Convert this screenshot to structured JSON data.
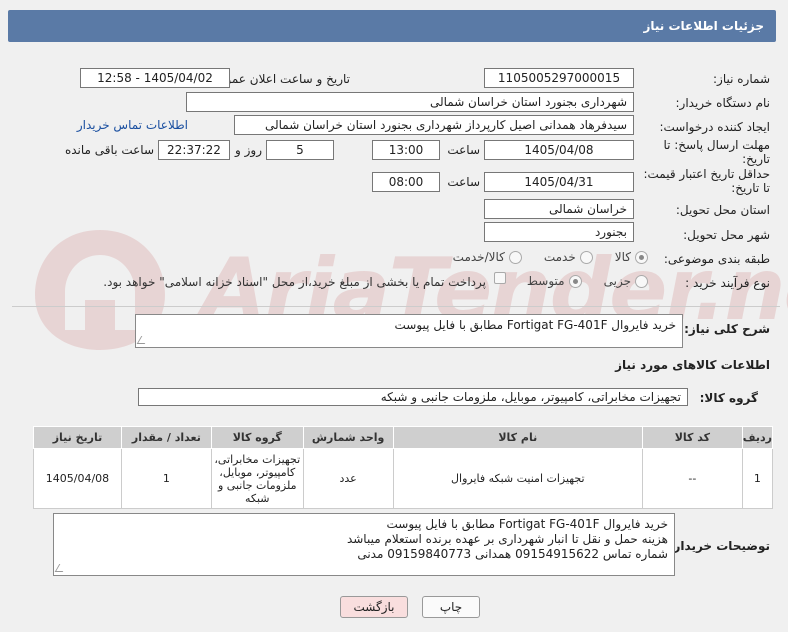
{
  "header": {
    "title": "جزئیات اطلاعات نیاز"
  },
  "form": {
    "need_number_label": "شماره نیاز:",
    "need_number": "1105005297000015",
    "announce_label": "تاریخ و ساعت اعلان عمومی:",
    "announce_value": "1405/04/02 - 12:58",
    "buyer_org_label": "نام دستگاه خریدار:",
    "buyer_org": "شهرداری بجنورد استان خراسان شمالی",
    "requester_label": "ایجاد کننده درخواست:",
    "requester": "سیدفرهاد همدانی اصیل کارپرداز شهرداری بجنورد استان خراسان شمالی",
    "contact_link": "اطلاعات تماس خریدار",
    "deadline_label": "مهلت ارسال پاسخ: تا تاریخ:",
    "deadline_date": "1405/04/08",
    "time_label": "ساعت",
    "deadline_time": "13:00",
    "days_value": "5",
    "days_label": "روز و",
    "remaining_time": "22:37:22",
    "remaining_label": "ساعت باقی مانده",
    "validity_label": "حداقل تاریخ اعتبار قیمت: تا تاریخ:",
    "validity_date": "1405/04/31",
    "validity_time": "08:00",
    "province_label": "استان محل تحویل:",
    "province": "خراسان شمالی",
    "city_label": "شهر محل تحویل:",
    "city": "بجنورد",
    "category_label": "طبقه بندی موضوعی:",
    "category_options": [
      "کالا",
      "خدمت",
      "کالا/خدمت"
    ],
    "process_label": "نوع فرآیند خرید :",
    "process_options": [
      "جزیی",
      "متوسط"
    ],
    "payment_note": "پرداخت تمام یا بخشی از مبلغ خرید،از محل \"اسناد خزانه اسلامی\" خواهد بود."
  },
  "summary": {
    "label": "شرح کلی نیاز:",
    "text": "خرید فایروال  Fortigat FG-401F  مطابق با فایل پیوست"
  },
  "goods": {
    "section_title": "اطلاعات کالاهای مورد نیاز",
    "group_label": "گروه کالا:",
    "group_value": "تجهیزات مخابراتی، کامپیوتر، موبایل، ملزومات جانبی و شبکه",
    "columns": [
      "ردیف",
      "کد کالا",
      "نام کالا",
      "واحد شمارش",
      "گروه کالا",
      "تعداد / مقدار",
      "تاریخ نیاز"
    ],
    "rows": [
      {
        "index": "1",
        "code": "--",
        "name": "تجهیزات امنیت شبکه فایروال",
        "unit": "عدد",
        "group": "تجهیزات مخابراتی، کامپیوتر، موبایل، ملزومات جانبی و شبکه",
        "qty": "1",
        "date": "1405/04/08"
      }
    ]
  },
  "notes": {
    "label": "توضیحات خریدار:",
    "line1": "خرید فایروال  Fortigat FG-401F  مطابق با فایل پیوست",
    "line2": "هزینه حمل و نقل تا انبار شهرداری بر عهده برنده استعلام میباشد",
    "line3": "شماره تماس 09154915622 همدانی 09159840773 مدنی"
  },
  "buttons": {
    "print": "چاپ",
    "back": "بازگشت"
  },
  "colors": {
    "header_bg": "#5a7aa6",
    "link": "#1a4fa0",
    "back_button_bg": "#f9dede"
  }
}
